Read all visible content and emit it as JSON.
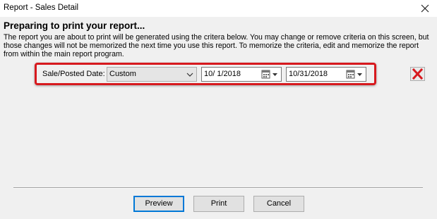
{
  "window": {
    "title": "Report - Sales Detail"
  },
  "heading": "Preparing to print your report...",
  "description": "The report you are about to print will be generated using the critera below. You may change or remove criteria on this screen, but those changes will not be memorized the next time you use this report.  To memorize the criteria, edit and memorize the report from within the main report program.",
  "criteria": {
    "label": "Sale/Posted Date:",
    "range_selected": "Custom",
    "from_date": "10/  1/2018",
    "to_date": "10/31/2018",
    "highlight_color": "#d7191e",
    "remove_icon_color": "#d7191e"
  },
  "buttons": {
    "preview": "Preview",
    "print": "Print",
    "cancel": "Cancel"
  }
}
